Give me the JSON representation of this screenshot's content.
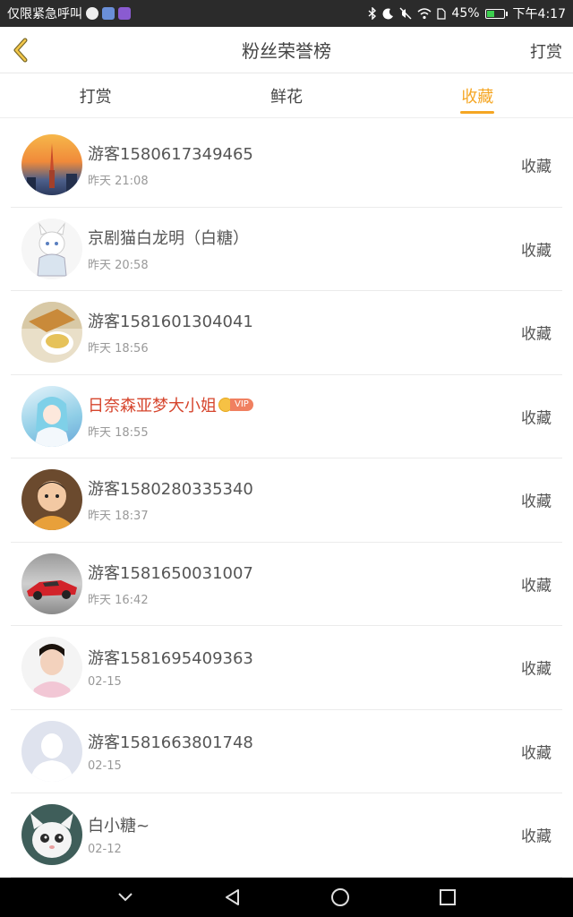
{
  "statusbar": {
    "left_text": "仅限紧急呼叫",
    "battery": "45%",
    "battery_level": 0.45,
    "time": "下午4:17"
  },
  "header": {
    "title": "粉丝荣誉榜",
    "right_label": "打赏"
  },
  "tabs": [
    {
      "label": "打赏",
      "active": false
    },
    {
      "label": "鲜花",
      "active": false
    },
    {
      "label": "收藏",
      "active": true
    }
  ],
  "colors": {
    "accent": "#f5a623",
    "vip_name": "#d6452d"
  },
  "list": [
    {
      "name": "游客1580617349465",
      "time": "昨天 21:08",
      "action": "收藏",
      "vip": false
    },
    {
      "name": "京剧猫白龙明（白糖）",
      "time": "昨天 20:58",
      "action": "收藏",
      "vip": false
    },
    {
      "name": "游客1581601304041",
      "time": "昨天 18:56",
      "action": "收藏",
      "vip": false
    },
    {
      "name": "日奈森亚梦大小姐",
      "time": "昨天 18:55",
      "action": "收藏",
      "vip": true,
      "vip_label": "VIP"
    },
    {
      "name": "游客1580280335340",
      "time": "昨天 18:37",
      "action": "收藏",
      "vip": false
    },
    {
      "name": "游客1581650031007",
      "time": "昨天 16:42",
      "action": "收藏",
      "vip": false
    },
    {
      "name": "游客1581695409363",
      "time": "02-15",
      "action": "收藏",
      "vip": false
    },
    {
      "name": "游客1581663801748",
      "time": "02-15",
      "action": "收藏",
      "vip": false
    },
    {
      "name": "白小糖~",
      "time": "02-12",
      "action": "收藏",
      "vip": false
    }
  ]
}
